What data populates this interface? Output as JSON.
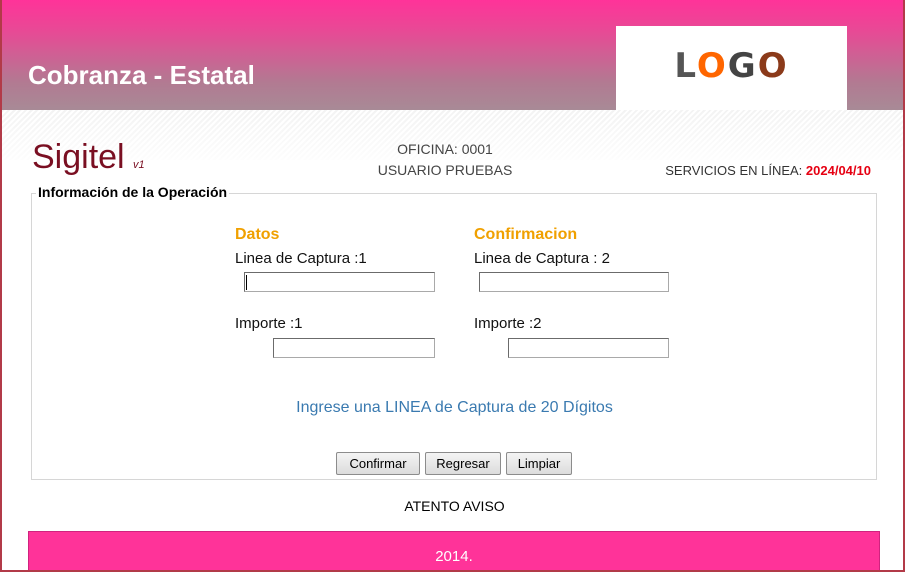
{
  "header": {
    "app_title": "Cobranza - Estatal",
    "logo_letters": [
      "L",
      "O",
      "G",
      "O"
    ],
    "colors": {
      "header_top": "#ff3399",
      "header_bottom": "#a88a96"
    }
  },
  "info_bar": {
    "brand": "Sigitel",
    "version": "v1",
    "office": "OFICINA: 0001",
    "user": "USUARIO PRUEBAS",
    "services_label": "SERVICIOS EN LÍNEA:",
    "services_date": "2024/04/10"
  },
  "panel": {
    "legend": "Información de la Operación",
    "datos": {
      "title": "Datos",
      "linea_label": "Linea de Captura :1",
      "linea_value": "",
      "importe_label": "Importe :1",
      "importe_value": ""
    },
    "confirmacion": {
      "title": "Confirmacion",
      "linea_label": "Linea de Captura : 2",
      "linea_value": "",
      "importe_label": "Importe :2",
      "importe_value": ""
    },
    "hint": "Ingrese una LINEA de Captura de 20 Dígitos",
    "buttons": {
      "confirm": "Confirmar",
      "back": "Regresar",
      "clear": "Limpiar"
    }
  },
  "notice": "ATENTO AVISO",
  "footer": {
    "text": "2014.",
    "color": "#ff3399"
  }
}
